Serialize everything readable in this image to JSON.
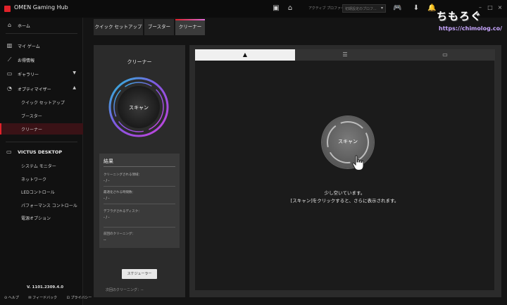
{
  "app": {
    "title": "OMEN Gaming Hub"
  },
  "titlebar": {
    "active_profile_label": "アクティブ プロファイル",
    "profile_value": "初期設定のプロフ..."
  },
  "watermark": {
    "text": "ちもろぐ",
    "url": "https://chimolog.co/"
  },
  "sidebar": {
    "home": "ホーム",
    "my_games": "マイ ゲーム",
    "deals": "お得情報",
    "gallery": "ギャラリー",
    "optimizer": "オプティマイザー",
    "optimizer_sub": [
      "クイック セットアップ",
      "ブースター",
      "クリーナー"
    ],
    "device_title": "VICTUS DESKTOP",
    "device_items": [
      "システム モニター",
      "ネットワーク",
      "LEDコントロール",
      "パフォーマンス コントロール",
      "電源オプション"
    ],
    "version": "V. 1101.2309.4.0",
    "footer": {
      "help": "ヘルプ",
      "feedback": "フィードバック",
      "privacy": "プライバシー"
    }
  },
  "tabs": [
    "クイック セットアップ",
    "ブースター",
    "クリーナー"
  ],
  "left_panel": {
    "title": "クリーナー",
    "scan_label": "スキャン",
    "results": {
      "title": "結果",
      "rows": [
        {
          "label": "クリーニングされる領域：",
          "value": "-  /  -"
        },
        {
          "label": "最適化される時間数：",
          "value": "-  /  -"
        },
        {
          "label": "デフラグされるディスク：",
          "value": "-  /  -"
        },
        {
          "label": "前回のクリーニング：",
          "value": "--"
        }
      ]
    },
    "scheduler_button": "スケジューラー",
    "next_cleaning": "次回のクリーニング：--"
  },
  "main_panel": {
    "scan_label": "スキャン",
    "message_1": "少し空いています。",
    "message_2": "[スキャン]をクリックすると、さらに表示されます。"
  },
  "colors": {
    "accent_red": "#e0222a",
    "ring_cyan": "#22d3ee",
    "ring_magenta": "#d946ef"
  }
}
